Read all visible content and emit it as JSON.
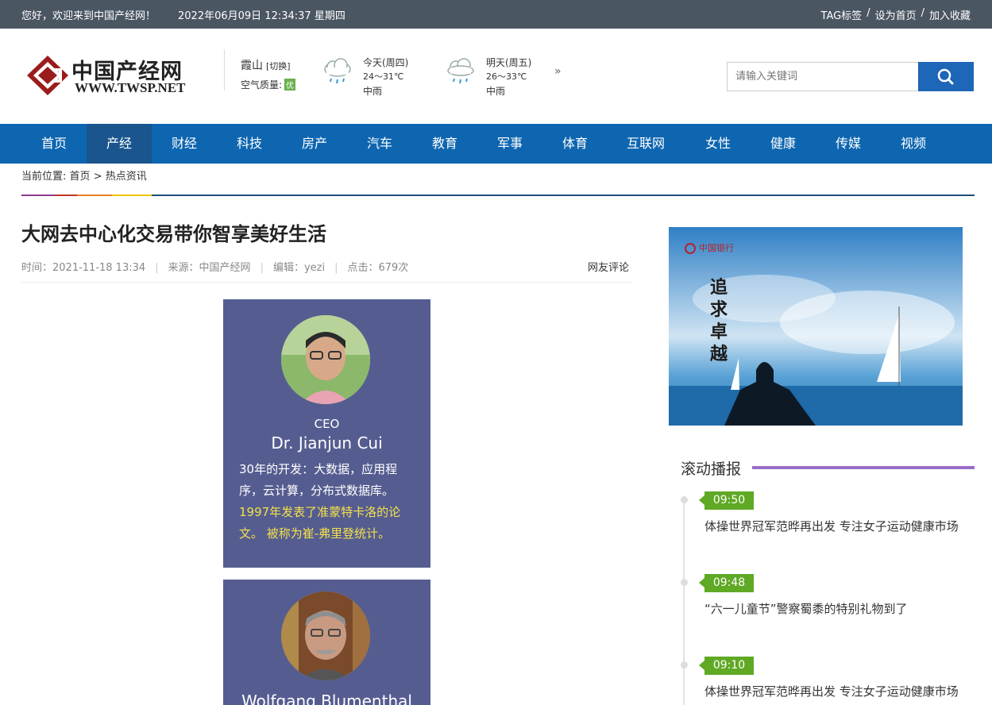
{
  "topbar": {
    "welcome": "您好，欢迎来到中国产经网！",
    "datetime": "2022年06月09日 12:34:37 星期四",
    "links": [
      "TAG标签",
      "设为首页",
      "加入收藏"
    ]
  },
  "logo": {
    "cn": "中国产经网",
    "en": "WWW.TWSP.NET"
  },
  "weather": {
    "city": "霞山",
    "switch": "[切换]",
    "aq_label": "空气质量:",
    "aq_value": "优",
    "days": [
      {
        "day": "今天(周四)",
        "temp": "24～31℃",
        "desc": "中雨"
      },
      {
        "day": "明天(周五)",
        "temp": "26～33℃",
        "desc": "中雨"
      }
    ]
  },
  "search": {
    "placeholder": "请输入关键词"
  },
  "nav": {
    "items": [
      "首页",
      "产经",
      "财经",
      "科技",
      "房产",
      "汽车",
      "教育",
      "军事",
      "体育",
      "互联网",
      "女性",
      "健康",
      "传媒",
      "视频"
    ],
    "active": "产经"
  },
  "breadcrumb": {
    "label": "当前位置:",
    "home": "首页",
    "sep": ">",
    "current": "热点资讯"
  },
  "article": {
    "title": "大网去中心化交易带你智享美好生活",
    "time": "时间：2021-11-18 13:34",
    "source": "来源：中国产经网",
    "editor": "编辑：yezi",
    "clicks": "点击：679次",
    "comment_link": "网友评论",
    "card1": {
      "role": "CEO",
      "name": "Dr. Jianjun Cui",
      "bio_plain": "30年的开发：大数据，应用程序，云计算，分布式数据库。",
      "bio_highlight": "1997年发表了准蒙特卡洛的论文。 被称为崔-弗里登统计。"
    },
    "card2": {
      "name": "Wolfgang Blumenthal"
    }
  },
  "sidebar": {
    "ad_brand": "中国银行",
    "ad_slogan": "追求卓越",
    "section_title": "滚动播报",
    "news": [
      {
        "time": "09:50",
        "text": "体操世界冠军范晔再出发 专注女子运动健康市场"
      },
      {
        "time": "09:48",
        "text": "“六一儿童节”警察蜀黍的特别礼物到了"
      },
      {
        "time": "09:10",
        "text": "体操世界冠军范晔再出发 专注女子运动健康市场"
      }
    ]
  },
  "colors": {
    "topbar": "#4b5663",
    "nav": "#0e66b0",
    "nav_active": "#1a558e",
    "search_button": "#1d66b8",
    "card_bg": "#555d90",
    "timeline_badge": "#5fa925",
    "section_line": "#9a6dc7"
  }
}
